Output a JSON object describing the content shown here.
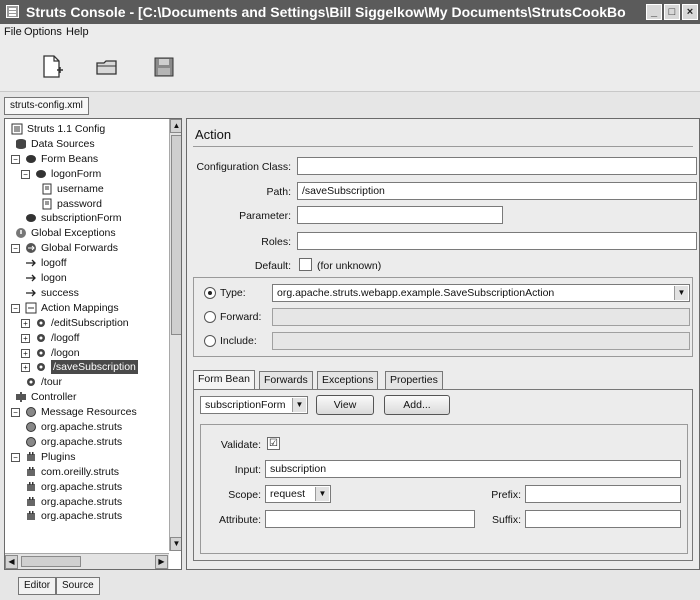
{
  "window": {
    "title": "Struts Console - [C:\\Documents and Settings\\Bill Siggelkow\\My Documents\\StrutsCookBook\\cod..."
  },
  "menu": [
    "File",
    "Options",
    "Help"
  ],
  "toolbar": {
    "buttons": [
      "new-file-icon",
      "open-folder-icon",
      "save-disk-icon"
    ]
  },
  "file_tab": "struts-config.xml",
  "tree": {
    "items": [
      {
        "label": "Struts 1.1 Config",
        "icon": "config-icon"
      },
      {
        "label": "Data Sources",
        "icon": "database-icon"
      },
      {
        "label": "Form Beans",
        "icon": "bean-icon",
        "expander": "−"
      },
      {
        "label": "logonForm",
        "icon": "bean-icon",
        "expander": "−"
      },
      {
        "label": "username",
        "icon": "property-icon"
      },
      {
        "label": "password",
        "icon": "property-icon"
      },
      {
        "label": "subscriptionForm",
        "icon": "bean-icon"
      },
      {
        "label": "Global Exceptions",
        "icon": "exception-icon"
      },
      {
        "label": "Global Forwards",
        "icon": "forward-icon",
        "expander": "−"
      },
      {
        "label": "logoff",
        "icon": "arrow-icon"
      },
      {
        "label": "logon",
        "icon": "arrow-icon"
      },
      {
        "label": "success",
        "icon": "arrow-icon"
      },
      {
        "label": "Action Mappings",
        "icon": "action-icon",
        "expander": "−"
      },
      {
        "label": "/editSubscription",
        "icon": "gear-icon",
        "expander": "+"
      },
      {
        "label": "/logoff",
        "icon": "gear-icon",
        "expander": "+"
      },
      {
        "label": "/logon",
        "icon": "gear-icon",
        "expander": "+"
      },
      {
        "label": "/saveSubscription",
        "icon": "gear-icon",
        "expander": "+",
        "selected": true
      },
      {
        "label": "/tour",
        "icon": "gear-icon"
      },
      {
        "label": "Controller",
        "icon": "controller-icon"
      },
      {
        "label": "Message Resources",
        "icon": "resources-icon",
        "expander": "−"
      },
      {
        "label": "org.apache.struts",
        "icon": "resources-icon"
      },
      {
        "label": "org.apache.struts",
        "icon": "resources-icon"
      },
      {
        "label": "Plugins",
        "icon": "plugin-icon",
        "expander": "−"
      },
      {
        "label": "com.oreilly.struts",
        "icon": "plugin-icon"
      },
      {
        "label": "org.apache.struts",
        "icon": "plugin-icon"
      },
      {
        "label": "org.apache.struts",
        "icon": "plugin-icon"
      },
      {
        "label": "org.apache.struts",
        "icon": "plugin-icon"
      }
    ]
  },
  "bottom_tabs": [
    "Editor",
    "Source"
  ],
  "action": {
    "title": "Action",
    "config_class_label": "Configuration Class:",
    "config_class_value": "",
    "path_label": "Path:",
    "path_value": "/saveSubscription",
    "parameter_label": "Parameter:",
    "parameter_value": "",
    "roles_label": "Roles:",
    "roles_value": "",
    "default_label": "Default:",
    "default_text": "(for unknown)",
    "type_label": "Type:",
    "type_value": "org.apache.struts.webapp.example.SaveSubscriptionAction",
    "forward_label": "Forward:",
    "include_label": "Include:",
    "selected_option": "Type"
  },
  "tabs": [
    "Form Bean",
    "Forwards",
    "Exceptions",
    "Properties"
  ],
  "form_bean": {
    "select_value": "subscriptionForm",
    "view_label": "View",
    "add_label": "Add...",
    "validate_label": "Validate:",
    "validate_checked": "☑",
    "input_label": "Input:",
    "input_value": "subscription",
    "scope_label": "Scope:",
    "scope_value": "request",
    "prefix_label": "Prefix:",
    "prefix_value": "",
    "attribute_label": "Attribute:",
    "attribute_value": "",
    "suffix_label": "Suffix:",
    "suffix_value": ""
  }
}
